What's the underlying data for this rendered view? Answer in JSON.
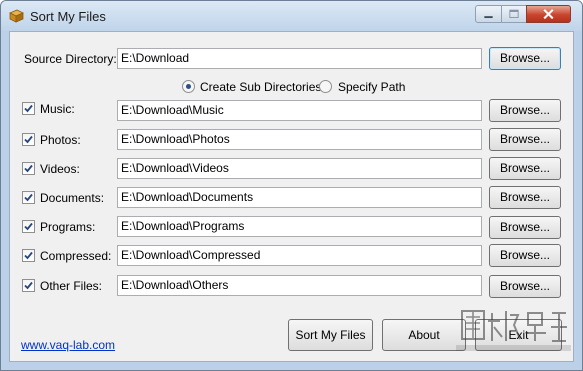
{
  "window": {
    "title": "Sort My Files",
    "controls": [
      "minimize-icon",
      "maximize-icon",
      "close-icon"
    ]
  },
  "source": {
    "label": "Source Directory:",
    "value": "E:\\Download",
    "browse": "Browse..."
  },
  "mode": {
    "options": [
      {
        "label": "Create Sub Directories",
        "selected": true
      },
      {
        "label": "Specify Path",
        "selected": false
      }
    ]
  },
  "categories": [
    {
      "label": "Music:",
      "checked": true,
      "path": "E:\\Download\\Music",
      "browse": "Browse..."
    },
    {
      "label": "Photos:",
      "checked": true,
      "path": "E:\\Download\\Photos",
      "browse": "Browse..."
    },
    {
      "label": "Videos:",
      "checked": true,
      "path": "E:\\Download\\Videos",
      "browse": "Browse..."
    },
    {
      "label": "Documents:",
      "checked": true,
      "path": "E:\\Download\\Documents",
      "browse": "Browse..."
    },
    {
      "label": "Programs:",
      "checked": true,
      "path": "E:\\Download\\Programs",
      "browse": "Browse..."
    },
    {
      "label": "Compressed:",
      "checked": true,
      "path": "E:\\Download\\Compressed",
      "browse": "Browse..."
    },
    {
      "label": "Other Files:",
      "checked": true,
      "path": "E:\\Download\\Others",
      "browse": "Browse..."
    }
  ],
  "footer": {
    "link": "www.vaq-lab.com",
    "sort_button": "Sort My Files",
    "about_button": "About",
    "exit_button": "Exit"
  },
  "colors": {
    "frame": "#bcd1e8",
    "close_button": "#c9452e",
    "link": "#0033cc",
    "default_button_border": "#3c7fb1"
  }
}
